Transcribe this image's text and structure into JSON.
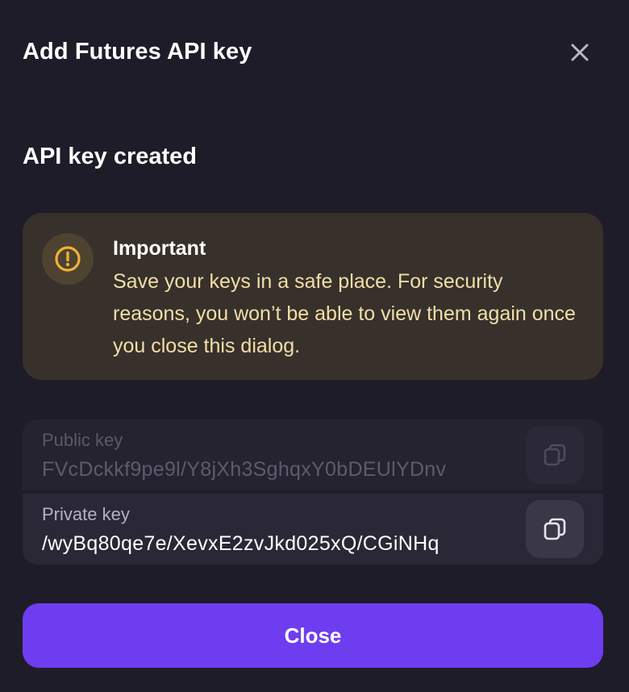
{
  "dialog": {
    "title": "Add Futures API key",
    "close_icon": "close-icon"
  },
  "status": {
    "heading": "API key created"
  },
  "notice": {
    "icon": "warning-icon",
    "title": "Important",
    "body": "Save your keys in a safe place. For security reasons, you won’t be able to view them again once you close this dialog.",
    "bg_color": "#38302b",
    "text_color": "#f1dfa8",
    "icon_color": "#f0b233"
  },
  "keys": {
    "public": {
      "label": "Public key",
      "value": "FVcDckkf9pe9l/Y8jXh3SghqxY0bDEUlYDnv",
      "copy_icon": "copy-icon"
    },
    "private": {
      "label": "Private key",
      "value": "/wyBq80qe7e/XevxE2zvJkd025xQ/CGiNHq",
      "copy_icon": "copy-icon"
    }
  },
  "actions": {
    "close_label": "Close",
    "accent_color": "#6e3df0"
  }
}
